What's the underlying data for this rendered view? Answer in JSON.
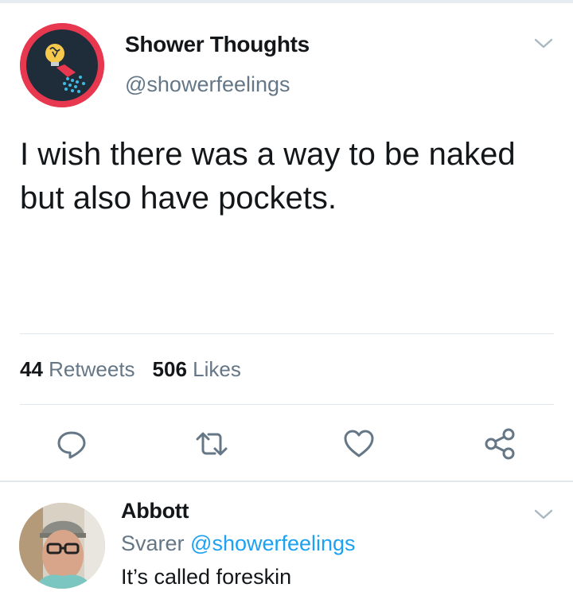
{
  "tweet": {
    "display_name": "Shower Thoughts",
    "handle": "@showerfeelings",
    "text": "I wish there was a way to be naked but also have pockets.",
    "stats": {
      "retweets_count": "44",
      "retweets_label": "Retweets",
      "likes_count": "506",
      "likes_label": "Likes"
    },
    "actions": [
      "reply",
      "retweet",
      "like",
      "share"
    ]
  },
  "reply": {
    "display_name": "Abbott",
    "context_prefix": "Svarer",
    "mention": "@showerfeelings",
    "text": "It’s called foreskin"
  },
  "colors": {
    "text_primary": "#14171a",
    "text_secondary": "#657786",
    "link": "#1da1f2",
    "avatar_ring": "#e8384f",
    "divider": "#e1e8ed"
  }
}
